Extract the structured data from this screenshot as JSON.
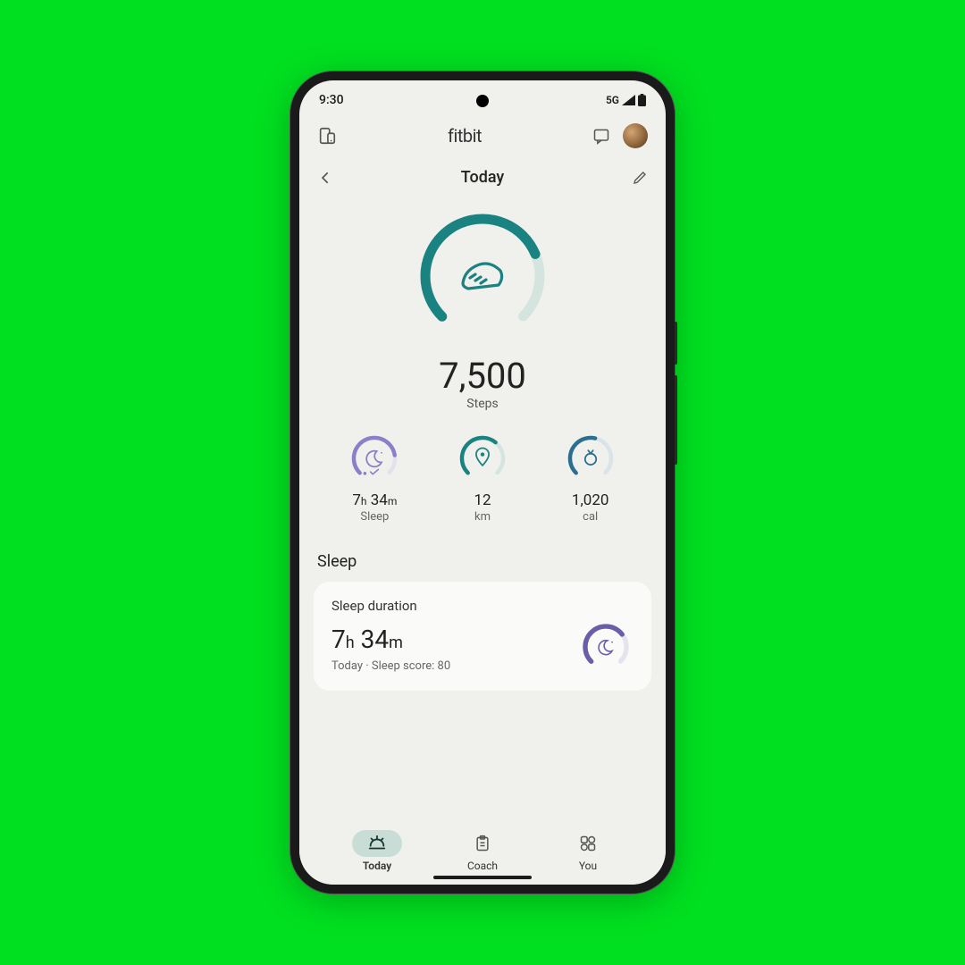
{
  "status": {
    "time": "9:30",
    "network": "5G"
  },
  "header": {
    "title": "fitbit"
  },
  "subheader": {
    "title": "Today"
  },
  "steps": {
    "value": "7,500",
    "label": "Steps",
    "progress": 0.75
  },
  "mini": [
    {
      "value_html": "7h 34m",
      "label": "Sleep",
      "progress": 0.8,
      "color": "#8b7fc7"
    },
    {
      "value_html": "12",
      "label": "km",
      "progress": 0.65,
      "color": "#1a8280"
    },
    {
      "value_html": "1,020",
      "label": "cal",
      "progress": 0.55,
      "color": "#2b6e8f"
    }
  ],
  "sleep_section": {
    "title": "Sleep"
  },
  "sleep_card": {
    "title": "Sleep duration",
    "value": "7h 34m",
    "subtext": "Today · Sleep score: 80",
    "progress": 0.7
  },
  "nav": [
    {
      "label": "Today",
      "active": true
    },
    {
      "label": "Coach",
      "active": false
    },
    {
      "label": "You",
      "active": false
    }
  ]
}
